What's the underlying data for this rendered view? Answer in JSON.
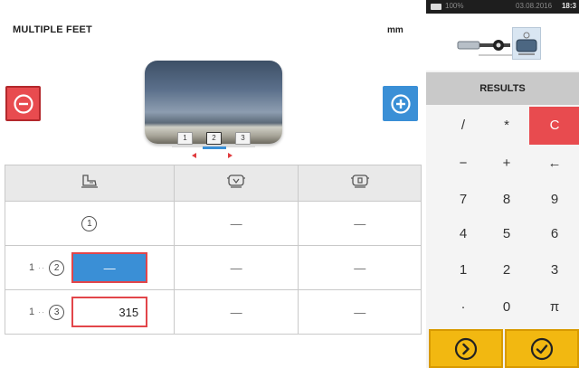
{
  "header": {
    "title": "MULTIPLE FEET",
    "unit": "mm"
  },
  "diagram": {
    "foot_tags": [
      "1",
      "2",
      "3"
    ]
  },
  "table": {
    "headers": [
      {
        "icon": "foot-icon"
      },
      {
        "icon": "front-feet-machine-icon"
      },
      {
        "icon": "back-feet-machine-icon"
      }
    ],
    "rows": [
      {
        "label": "1",
        "value": "",
        "col2": "—",
        "col3": "—"
      },
      {
        "from": "1",
        "to": "2",
        "value": "—",
        "col2": "—",
        "col3": "—"
      },
      {
        "from": "1",
        "to": "3",
        "value": "315",
        "col2": "—",
        "col3": "—"
      }
    ]
  },
  "status_bar": {
    "left_text": "100%",
    "date": "03.08.2016",
    "time": "18:3"
  },
  "right_panel": {
    "results_label": "RESULTS",
    "keypad": [
      [
        "/",
        "*",
        "C"
      ],
      [
        "−",
        "+",
        "←"
      ],
      [
        "7",
        "8",
        "9"
      ],
      [
        "4",
        "5",
        "6"
      ],
      [
        "1",
        "2",
        "3"
      ],
      [
        "·",
        "0",
        "π"
      ]
    ],
    "next_icon": "chevron-right-circle-icon",
    "confirm_icon": "check-circle-icon"
  },
  "colors": {
    "red": "#e84b4f",
    "blue": "#3a8fd6",
    "yellow": "#f2b811"
  }
}
